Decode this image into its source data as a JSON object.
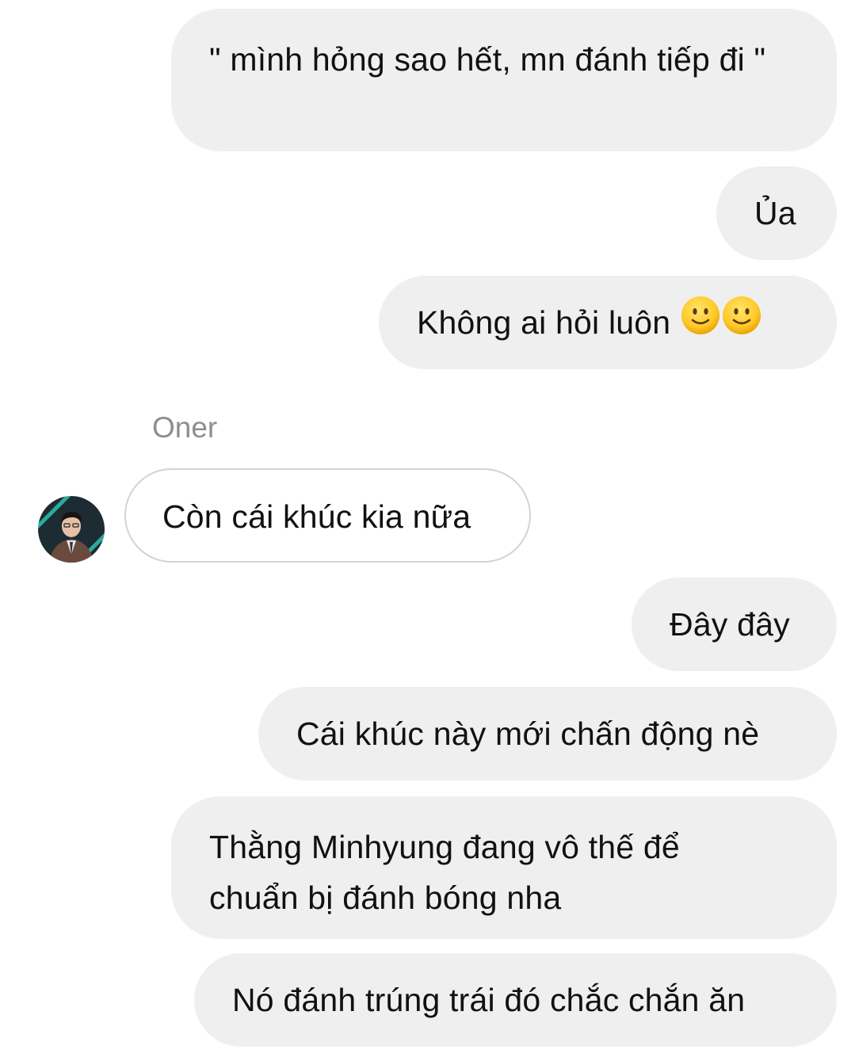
{
  "conversation": {
    "messages": [
      {
        "id": "m1",
        "direction": "outgoing",
        "text": "\" mình hỏng sao hết, mn đánh tiếp đi \""
      },
      {
        "id": "m2",
        "direction": "outgoing",
        "text": "Ủa"
      },
      {
        "id": "m3",
        "direction": "outgoing",
        "text": "Không ai hỏi luôn",
        "emojis": [
          "slightly-smiling-face",
          "slightly-smiling-face"
        ]
      },
      {
        "id": "m4",
        "direction": "incoming",
        "sender": "Oner",
        "text": "Còn cái khúc kia nữa"
      },
      {
        "id": "m5",
        "direction": "outgoing",
        "text": "Đây đây"
      },
      {
        "id": "m6",
        "direction": "outgoing",
        "text": "Cái khúc này mới chấn động nè"
      },
      {
        "id": "m7",
        "direction": "outgoing",
        "text": "Thằng Minhyung đang vô thế để chuẩn bị đánh bóng nha"
      },
      {
        "id": "m8",
        "direction": "outgoing",
        "text": "Nó đánh trúng trái đó chắc chắn ăn"
      }
    ]
  },
  "colors": {
    "outgoing_bubble": "#efefef",
    "incoming_bubble_border": "#d3d3d3",
    "sender_name": "#8e8e8e"
  }
}
